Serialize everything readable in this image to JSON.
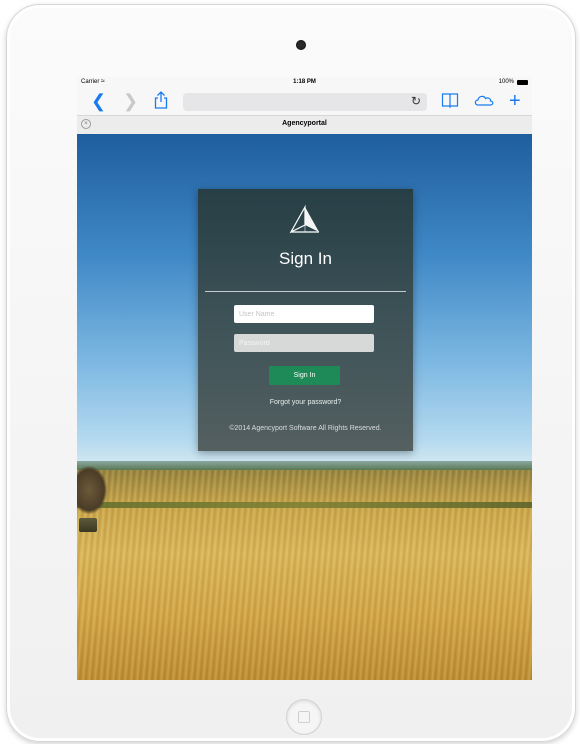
{
  "status_bar": {
    "carrier": "Carrier",
    "time": "1:18 PM",
    "battery": "100%"
  },
  "toolbar": {
    "icons": [
      "back-icon",
      "forward-icon",
      "share-icon",
      "reload-icon",
      "bookmarks-icon",
      "cloud-tabs-icon",
      "new-tab-icon"
    ]
  },
  "tab": {
    "title": "Agencyportal"
  },
  "login": {
    "title": "Sign In",
    "username_placeholder": "User Name",
    "password_placeholder": "Password",
    "signin_label": "Sign In",
    "forgot_label": "Forgot your password?",
    "copyright": "©2014 Agencyport Software All Rights Reserved."
  },
  "colors": {
    "accent": "#1a7bf0",
    "signin_button": "#1e8a57",
    "card": "#3a4a4a"
  }
}
